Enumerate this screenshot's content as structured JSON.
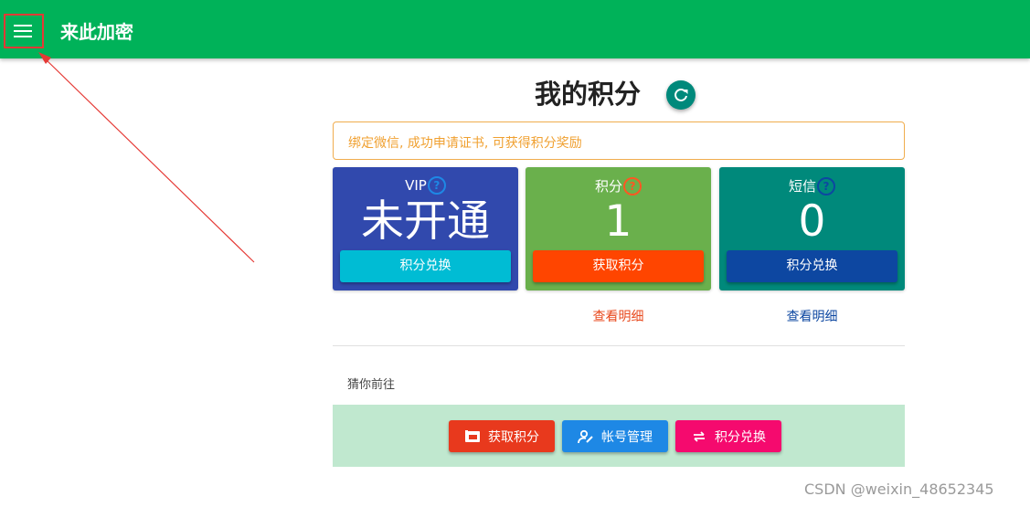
{
  "appbar": {
    "title": "来此加密"
  },
  "page": {
    "title": "我的积分"
  },
  "notice": {
    "text": "绑定微信, 成功申请证书, 可获得积分奖励"
  },
  "cards": [
    {
      "label": "VIP",
      "value": "未开通",
      "button": "积分兑换",
      "color": "#3149ad",
      "button_color": "#00bcd4",
      "help_color": "#1e88e5"
    },
    {
      "label": "积分",
      "value": "1",
      "button": "获取积分",
      "detail_link": "查看明细",
      "color": "#6ab04c",
      "button_color": "#ff4500",
      "help_color": "#ff5722"
    },
    {
      "label": "短信",
      "value": "0",
      "button": "积分兑换",
      "detail_link": "查看明细",
      "color": "#00897b",
      "button_color": "#0d47a1",
      "help_color": "#0d47a1"
    }
  ],
  "help_glyph": "?",
  "quick": {
    "label": "猜你前往",
    "buttons": [
      {
        "label": "获取积分",
        "icon": "wallet-icon",
        "color": "#e8391d"
      },
      {
        "label": "帐号管理",
        "icon": "user-edit-icon",
        "color": "#1e88e5"
      },
      {
        "label": "积分兑换",
        "icon": "swap-icon",
        "color": "#f50a6e"
      }
    ]
  },
  "watermark": "CSDN @weixin_48652345"
}
